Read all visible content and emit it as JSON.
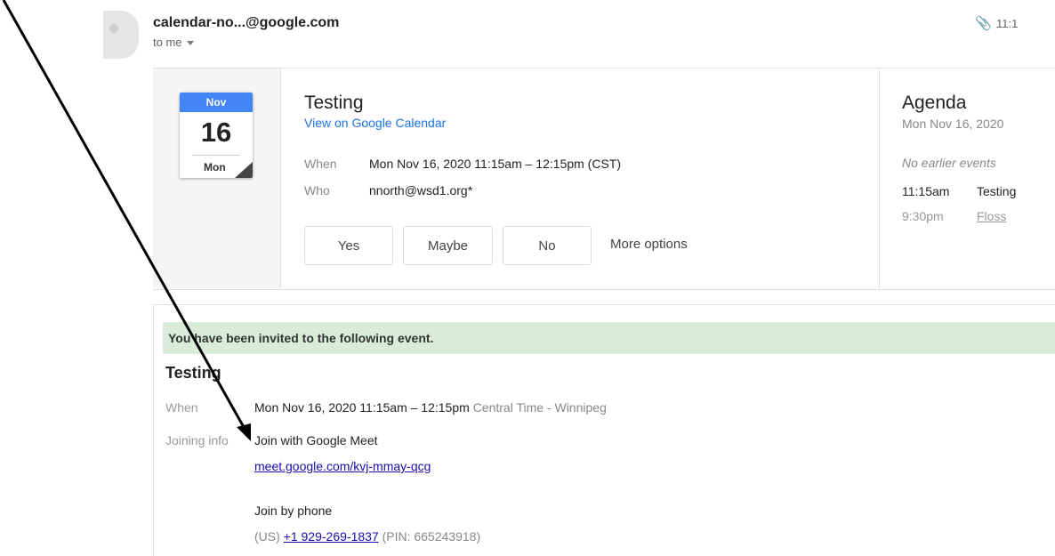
{
  "header": {
    "sender": "calendar-no...@google.com",
    "to": "to me",
    "time": "11:1"
  },
  "invite": {
    "month": "Nov",
    "day": "16",
    "weekday": "Mon",
    "title": "Testing",
    "calendar_link": "View on Google Calendar",
    "when_label": "When",
    "when_value": "Mon Nov 16, 2020 11:15am – 12:15pm (CST)",
    "who_label": "Who",
    "who_value": "nnorth@wsd1.org*",
    "rsvp": {
      "yes": "Yes",
      "maybe": "Maybe",
      "no": "No",
      "more": "More options"
    }
  },
  "agenda": {
    "title": "Agenda",
    "date": "Mon Nov 16, 2020",
    "no_earlier": "No earlier events",
    "events": [
      {
        "time": "11:15am",
        "name": "Testing"
      },
      {
        "time": "9:30pm",
        "name": "Floss"
      }
    ]
  },
  "description": {
    "banner": "You have been invited to the following event.",
    "title": "Testing",
    "when_label": "When",
    "when_value": "Mon Nov 16, 2020 11:15am – 12:15pm",
    "timezone": "Central Time - Winnipeg",
    "joining_label": "Joining info",
    "meet_text": "Join with Google Meet",
    "meet_link": "meet.google.com/kvj-mmay-qcg",
    "phone_heading": "Join by phone",
    "phone_country": "(US)",
    "phone_number": "+1 929-269-1837",
    "phone_pin": "(PIN: 665243918)"
  },
  "icons": {
    "attachment": "paperclip-icon",
    "dropdown": "caret-down-icon"
  }
}
